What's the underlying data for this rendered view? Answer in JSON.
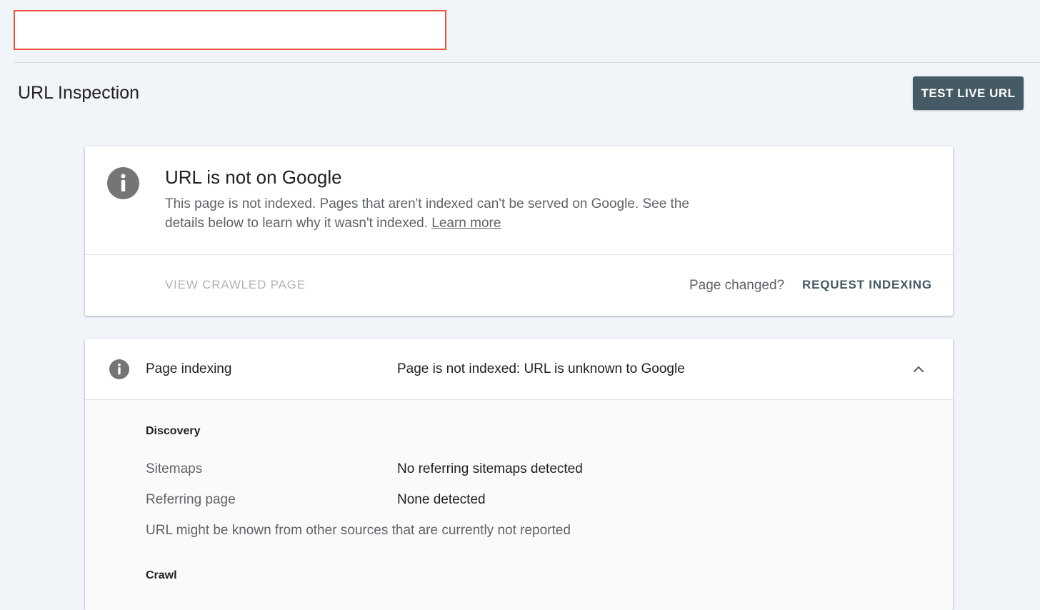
{
  "header": {
    "url_input_value": "",
    "page_title": "URL Inspection",
    "test_live_url_label": "TEST LIVE URL"
  },
  "status_card": {
    "icon": "info-icon",
    "heading": "URL is not on Google",
    "description": "This page is not indexed. Pages that aren't indexed can't be served on Google. See the details below to learn why it wasn't indexed.",
    "learn_more_label": "Learn more",
    "view_crawled_label": "VIEW CRAWLED PAGE",
    "page_changed_label": "Page changed?",
    "request_indexing_label": "REQUEST INDEXING"
  },
  "indexing_card": {
    "icon": "info-icon",
    "label": "Page indexing",
    "value": "Page is not indexed: URL is unknown to Google",
    "chevron": "chevron-up-icon",
    "discovery": {
      "title": "Discovery",
      "rows": [
        {
          "label": "Sitemaps",
          "value": "No referring sitemaps detected"
        },
        {
          "label": "Referring page",
          "value": "None detected"
        }
      ],
      "note": "URL might be known from other sources that are currently not reported"
    },
    "crawl": {
      "title": "Crawl"
    }
  },
  "colors": {
    "background": "#f1f4f9",
    "accent_button": "#455a64",
    "url_box_border": "#e8553f",
    "icon_grey": "#757575"
  }
}
